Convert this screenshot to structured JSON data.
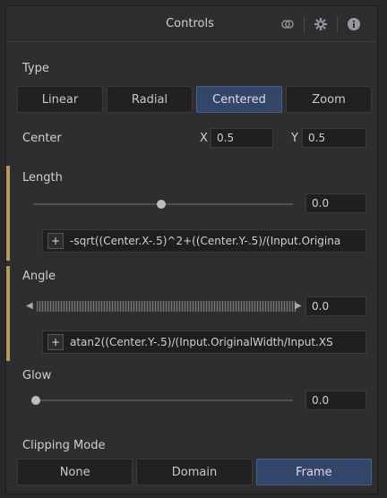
{
  "header": {
    "title": "Controls",
    "icons": [
      "link-icon",
      "gear-icon",
      "info-icon"
    ]
  },
  "type": {
    "label": "Type",
    "options": [
      "Linear",
      "Radial",
      "Centered",
      "Zoom"
    ],
    "selected": "Centered"
  },
  "center": {
    "label": "Center",
    "x_label": "X",
    "x_value": "0.5",
    "y_label": "Y",
    "y_value": "0.5"
  },
  "length": {
    "label": "Length",
    "value": "0.0",
    "slider_fraction": 0.53,
    "expression": "-sqrt((Center.X-.5)^2+((Center.Y-.5)/(Input.Origina"
  },
  "angle": {
    "label": "Angle",
    "value": "0.0",
    "expression": "atan2((Center.Y-.5)/(Input.OriginalWidth/Input.XS"
  },
  "glow": {
    "label": "Glow",
    "value": "0.0",
    "slider_fraction": 0.0
  },
  "clipping": {
    "label": "Clipping Mode",
    "options": [
      "None",
      "Domain",
      "Frame"
    ],
    "selected": "Frame"
  },
  "plus_label": "+",
  "colors": {
    "accent": "#b59a58",
    "selected": "#34456a"
  }
}
